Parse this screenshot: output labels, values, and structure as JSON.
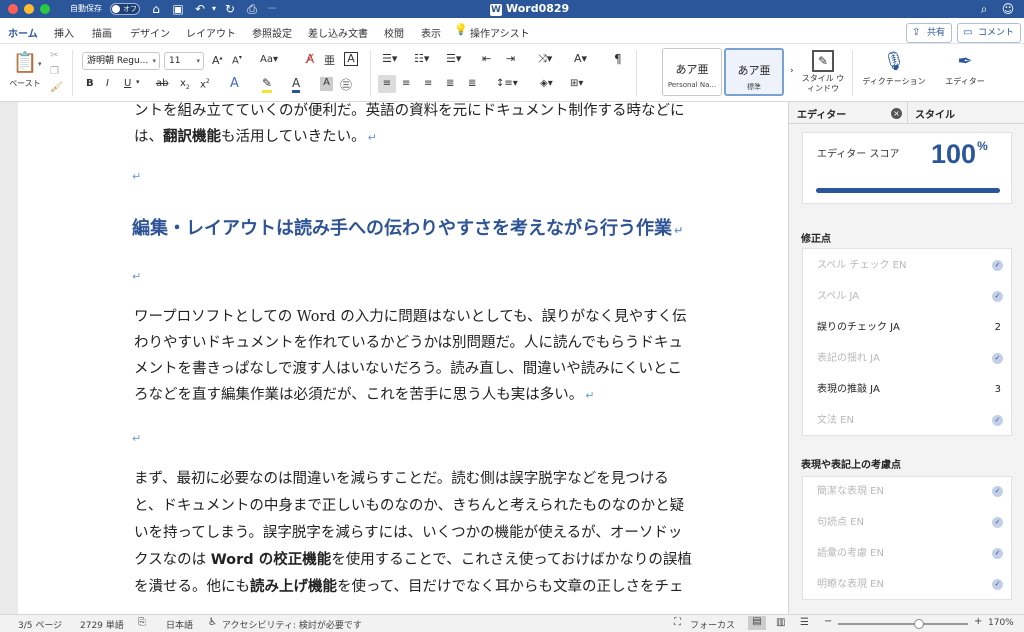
{
  "titlebar": {
    "autosave_label": "自動保存",
    "autosave_state": "オフ",
    "doc_title": "Word0829",
    "doc_icon": "W"
  },
  "tabs": [
    {
      "label": "ホーム",
      "active": true
    },
    {
      "label": "挿入"
    },
    {
      "label": "描画"
    },
    {
      "label": "デザイン"
    },
    {
      "label": "レイアウト"
    },
    {
      "label": "参照設定"
    },
    {
      "label": "差し込み文書"
    },
    {
      "label": "校閲"
    },
    {
      "label": "表示"
    },
    {
      "label": "操作アシスト"
    }
  ],
  "top_buttons": {
    "share": "共有",
    "comment": "コメント"
  },
  "ribbon": {
    "paste_label": "ペースト",
    "font_name": "游明朝 Regu...",
    "font_size": "11",
    "styles": [
      {
        "preview": "あア亜",
        "name": "Personal Na..."
      },
      {
        "preview": "あア亜",
        "name": "標準",
        "selected": true
      }
    ],
    "style_window_label": "スタイル ウィンドウ",
    "dictation_label": "ディクテーション",
    "editor_label": "エディター"
  },
  "document": {
    "line_1": "ントを組み立てていくのが便利だ。英語の資料を元にドキュメント制作する時などに",
    "line_2_pre": "は、",
    "line_2_bold": "翻訳機能",
    "line_2_post": "も活用していきたい。",
    "heading": "編集・レイアウトは読み手への伝わりやすさを考えながら行う作業",
    "p2_l1": "ワープロソフトとしての Word の入力に問題はないとしても、誤りがなく見やすく伝",
    "p2_l2": "わりやすいドキュメントを作れているかどうかは別問題だ。人に読んでもらうドキュ",
    "p2_l3": "メントを書きっぱなしで渡す人はいないだろう。読み直し、間違いや読みにくいとこ",
    "p2_l4": "ろなどを直す編集作業は必須だが、これを苦手に思う人も実は多い。",
    "p3_l1": "まず、最初に必要なのは間違いを減らすことだ。読む側は誤字脱字などを見つける",
    "p3_l2": "と、ドキュメントの中身まで正しいものなのか、きちんと考えられたものなのかと疑",
    "p3_l3": "いを持ってしまう。誤字脱字を減らすには、いくつかの機能が使えるが、オーソドッ",
    "p3_l4_pre": "クスなのは ",
    "p3_l4_bold": "Word の校正機能",
    "p3_l4_post": "を使用することで、これさえ使っておけばかなりの誤植",
    "p3_l5_pre": "を潰せる。他にも",
    "p3_l5_bold": "読み上げ機能",
    "p3_l5_post": "を使って、目だけでなく耳からも文章の正しさをチェ"
  },
  "pane": {
    "tab_editor": "エディター",
    "tab_style": "スタイル",
    "score_label": "エディター スコア",
    "score_value": "100",
    "score_unit": "%",
    "score_fraction": 1.0,
    "section_corrections": "修正点",
    "corrections": [
      {
        "label": "スペル チェック  EN",
        "status": "check"
      },
      {
        "label": "スペル  JA",
        "status": "check"
      },
      {
        "label": "誤りのチェック  JA",
        "count": "2"
      },
      {
        "label": "表記の揺れ  JA",
        "status": "check"
      },
      {
        "label": "表現の推敲  JA",
        "count": "3"
      },
      {
        "label": "文法  EN",
        "status": "check"
      }
    ],
    "section_refinements": "表現や表記上の考慮点",
    "refinements": [
      {
        "label": "簡潔な表現  EN",
        "status": "check"
      },
      {
        "label": "句読点  EN",
        "status": "check"
      },
      {
        "label": "語彙の考慮  EN",
        "status": "check"
      },
      {
        "label": "明瞭な表現  EN",
        "status": "check"
      }
    ]
  },
  "statusbar": {
    "page": "3/5 ページ",
    "words": "2729 単語",
    "language": "日本語",
    "accessibility": "アクセシビリティ: 検討が必要です",
    "focus": "フォーカス",
    "zoom": "170%",
    "zoom_fraction": 0.62
  },
  "colors": {
    "brand": "#2b579a",
    "heading": "#2f5496",
    "para_mark": "#6b9bd1"
  }
}
